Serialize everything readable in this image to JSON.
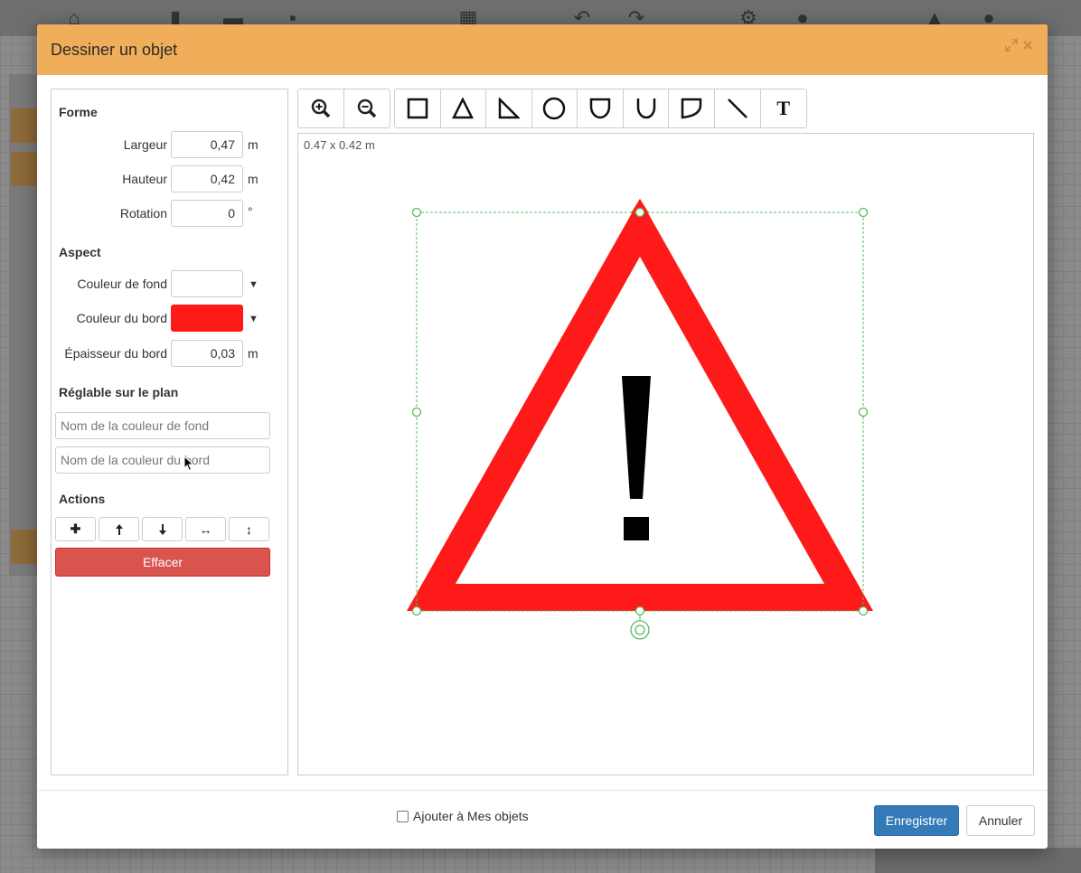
{
  "dialog": {
    "title": "Dessiner un objet"
  },
  "forme": {
    "title": "Forme",
    "largeur_label": "Largeur",
    "largeur_value": "0,47",
    "largeur_unit": "m",
    "hauteur_label": "Hauteur",
    "hauteur_value": "0,42",
    "hauteur_unit": "m",
    "rotation_label": "Rotation",
    "rotation_value": "0",
    "rotation_unit": "°"
  },
  "aspect": {
    "title": "Aspect",
    "fond_label": "Couleur de fond",
    "fond_color": "#ffffff",
    "bord_label": "Couleur du bord",
    "bord_color": "#ff1a1a",
    "epaisseur_label": "Épaisseur du bord",
    "epaisseur_value": "0,03",
    "epaisseur_unit": "m",
    "caret": "▼"
  },
  "reglable": {
    "title": "Réglable sur le plan",
    "fond_placeholder": "Nom de la couleur de fond",
    "bord_placeholder": "Nom de la couleur du bord"
  },
  "actions": {
    "title": "Actions",
    "buttons": [
      "add-icon",
      "arrow-up-icon",
      "arrow-down-icon",
      "arrows-horizontal-icon",
      "arrows-vertical-icon"
    ],
    "add_glyph": "✚",
    "up_glyph": "🡑",
    "down_glyph": "🡓",
    "h_glyph": "↔",
    "v_glyph": "↕",
    "effacer": "Effacer"
  },
  "toolbar": {
    "tools": [
      "zoom-in-icon",
      "zoom-out-icon",
      "square-icon",
      "triangle-icon",
      "right-triangle-icon",
      "circle-icon",
      "shield-icon",
      "u-shape-icon",
      "d-shape-icon",
      "line-icon",
      "text-icon"
    ],
    "text_tool": "T"
  },
  "canvas": {
    "dimensions": "0.47 x 0.42 m",
    "exclamation": "!",
    "shape_stroke": "#ff1a1a",
    "selection_color": "#5cb85c"
  },
  "footer": {
    "checkbox_label": "Ajouter à Mes objets",
    "save": "Enregistrer",
    "cancel": "Annuler"
  },
  "colors": {
    "header": "#f0ad5a",
    "primary": "#337ab7",
    "danger": "#d9534f"
  }
}
